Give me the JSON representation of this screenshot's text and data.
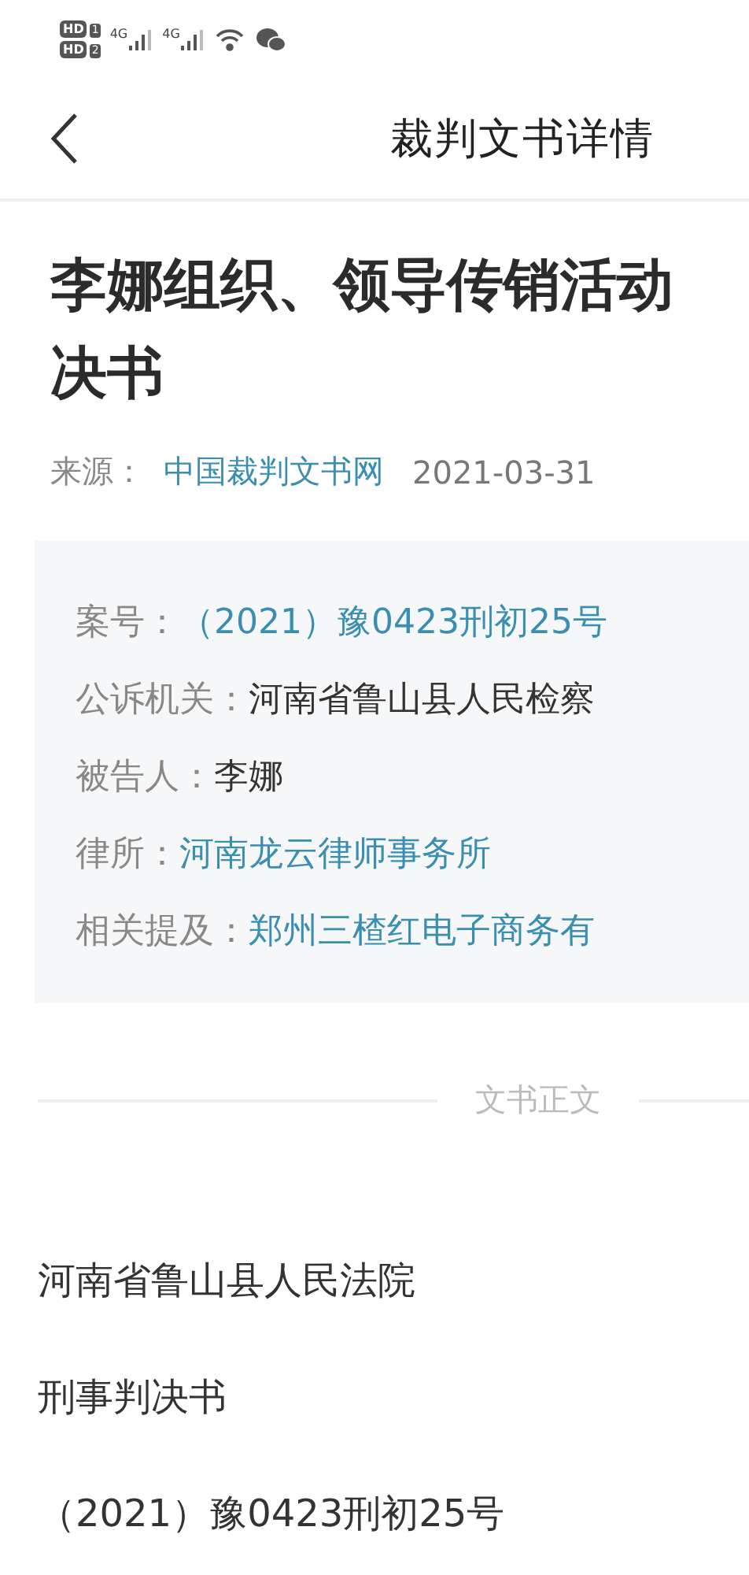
{
  "status_bar": {
    "sims": [
      {
        "badge": "HD",
        "slot": "1"
      },
      {
        "badge": "HD",
        "slot": "2"
      }
    ],
    "networks": [
      "4G",
      "4G"
    ]
  },
  "nav": {
    "title": "裁判文书详情"
  },
  "title_lines": [
    "李娜组织、领导传销活动",
    "决书"
  ],
  "source": {
    "label": "来源：",
    "name": "中国裁判文书网",
    "date": "2021-03-31"
  },
  "info": [
    {
      "label": "案号：",
      "value": "（2021）豫0423刑初25号",
      "kind": "link"
    },
    {
      "label": "公诉机关：",
      "value": "河南省鲁山县人民检察",
      "kind": "plain"
    },
    {
      "label": "被告人：",
      "value": "李娜",
      "kind": "plain"
    },
    {
      "label": "律所：",
      "value": "河南龙云律师事务所",
      "kind": "link"
    },
    {
      "label": "相关提及：",
      "value": "郑州三楂红电子商务有",
      "kind": "link"
    }
  ],
  "section_divider": "文书正文",
  "body": [
    "河南省鲁山县人民法院",
    "刑事判决书",
    "（2021）豫0423刑初25号"
  ]
}
